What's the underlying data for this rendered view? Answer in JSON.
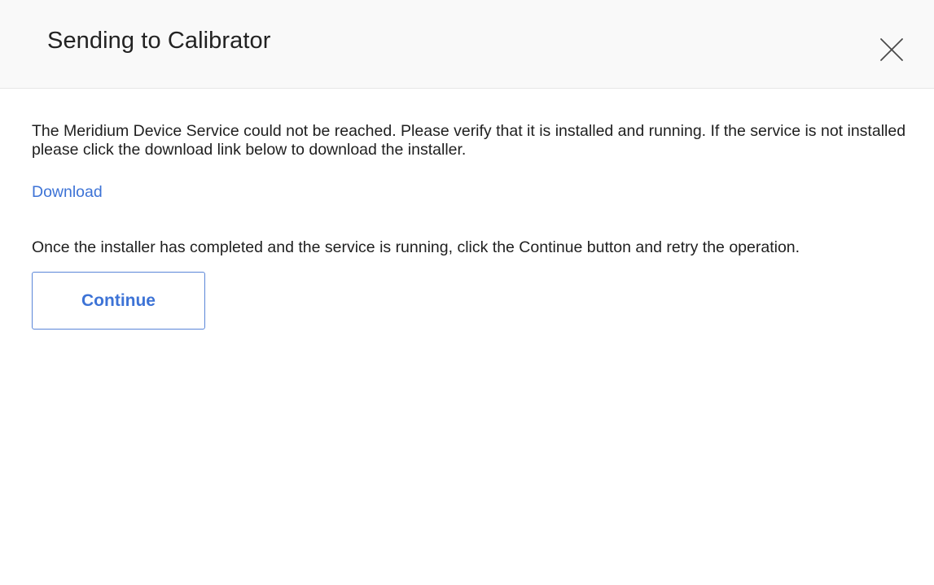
{
  "dialog": {
    "title": "Sending to Calibrator",
    "close_icon": "close-icon"
  },
  "body": {
    "message": "The Meridium Device Service could not be reached. Please verify that it is installed and running. If the service is not installed please click the download link below to download the installer.",
    "download_link": "Download",
    "instructions": "Once the installer has completed and the service is running, click the Continue button and retry the operation.",
    "continue_label": "Continue"
  },
  "colors": {
    "link": "#3d73d6",
    "button_border": "#5a86d8",
    "header_bg": "#f9f9f9"
  }
}
